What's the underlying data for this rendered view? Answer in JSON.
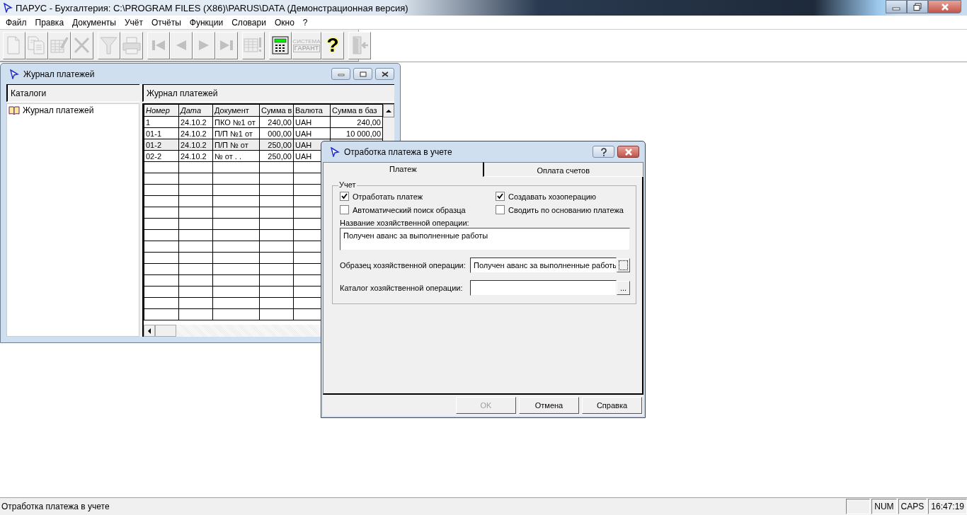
{
  "window": {
    "title": "ПАРУС - Бухгалтерия: C:\\PROGRAM FILES (X86)\\PARUS\\DATA (Демонстрационная версия)"
  },
  "menu": [
    "Файл",
    "Правка",
    "Документы",
    "Учёт",
    "Отчёты",
    "Функции",
    "Словари",
    "Окно",
    "?"
  ],
  "toolbar": [
    [
      {
        "kind": "new",
        "disabled": true
      },
      {
        "kind": "copy",
        "disabled": true
      },
      {
        "kind": "edit",
        "disabled": true
      },
      {
        "kind": "delete",
        "disabled": true
      }
    ],
    [
      {
        "kind": "filter",
        "disabled": true
      },
      {
        "kind": "print",
        "disabled": true
      }
    ],
    [
      {
        "kind": "first",
        "disabled": true
      },
      {
        "kind": "prev",
        "disabled": true
      },
      {
        "kind": "next",
        "disabled": true
      },
      {
        "kind": "last",
        "disabled": true
      }
    ],
    [
      {
        "kind": "table-alert",
        "disabled": true
      }
    ],
    [
      {
        "kind": "calculator",
        "disabled": false
      },
      {
        "kind": "garant",
        "disabled": true,
        "label": [
          "СИСТЕМА",
          "ГАРАНТ"
        ]
      },
      {
        "kind": "help",
        "disabled": false,
        "label": "?"
      }
    ],
    [
      {
        "kind": "exit",
        "disabled": true
      }
    ]
  ],
  "journal_window": {
    "title": "Журнал платежей",
    "catalog_pane": {
      "header": "Каталоги",
      "items": [
        {
          "label": "Журнал платежей",
          "selected": false
        }
      ]
    },
    "list_pane": {
      "header": "Журнал платежей",
      "columns": [
        {
          "label": "Номер",
          "sorted": true
        },
        {
          "label": "Дата",
          "sorted": true
        },
        {
          "label": "Документ",
          "sorted": false
        },
        {
          "label": "Сумма в",
          "sorted": false
        },
        {
          "label": "Валюта",
          "sorted": false
        },
        {
          "label": "Сумма в баз",
          "sorted": false
        }
      ],
      "rows": [
        {
          "selected": false,
          "cells": [
            "1",
            "24.10.2",
            "ПКО №1 от",
            "240,00",
            "UAH",
            "240,00"
          ]
        },
        {
          "selected": false,
          "cells": [
            "01-1",
            "24.10.2",
            "П/П №1 от",
            "000,00",
            "UAH",
            "10 000,00"
          ]
        },
        {
          "selected": true,
          "cells": [
            "01-2",
            "24.10.2",
            "П/П № от",
            "250,00",
            "UAH"
          ]
        },
        {
          "selected": false,
          "cells": [
            "02-2",
            "24.10.2",
            "№ от  .  .",
            "250,00",
            "UAH"
          ]
        }
      ]
    }
  },
  "dialog": {
    "title": "Отработка платежа в учете",
    "tabs": [
      {
        "label": "Платеж",
        "selected": true
      },
      {
        "label": "Оплата счетов",
        "selected": false
      }
    ],
    "group": {
      "title": "Учет",
      "checkboxes": [
        {
          "label": "Отработать платеж",
          "checked": true
        },
        {
          "label": "Создавать хозоперацию",
          "checked": true
        },
        {
          "label": "Автоматический поиск образца",
          "checked": false
        },
        {
          "label": "Сводить по основанию платежа",
          "checked": false
        }
      ],
      "name_label": "Название хозяйственной операции:",
      "name_value": "Получен аванс за выполненные работы",
      "fields": [
        {
          "label": "Образец хозяйственной операции:",
          "value": "Получен аванс за выполненные работь",
          "button_focused": true
        },
        {
          "label": "Каталог хозяйственной операции:",
          "button_label": "...",
          "button_focused": false
        }
      ]
    },
    "buttons": [
      {
        "label": "OK",
        "disabled": true
      },
      {
        "label": "Отмена",
        "disabled": false
      },
      {
        "label": "Справка",
        "disabled": false
      }
    ]
  },
  "status_bar": {
    "message": "Отработка платежа в учете",
    "panels": [
      "NUM",
      "CAPS",
      "16:47:19"
    ]
  }
}
